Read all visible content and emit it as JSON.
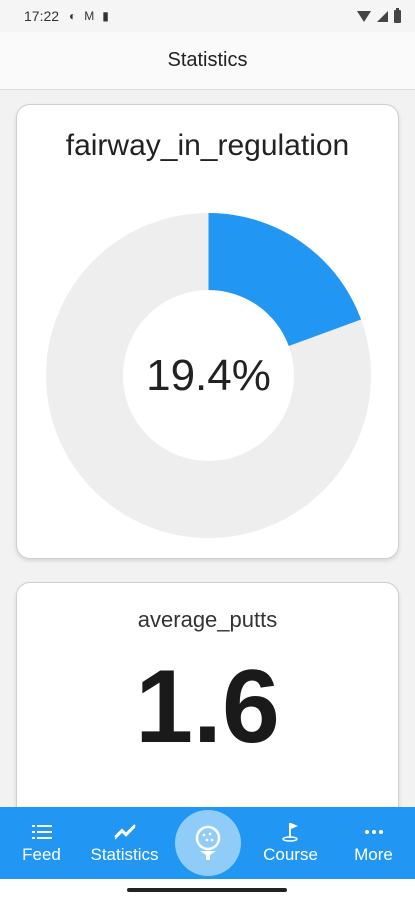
{
  "status_bar": {
    "time": "17:22"
  },
  "app_bar": {
    "title": "Statistics"
  },
  "cards": [
    {
      "title": "fairway_in_regulation",
      "value_label": "19.4%",
      "fraction": 0.194,
      "fill_color": "#2196f3",
      "track_color": "#eeeeee"
    },
    {
      "title": "average_putts",
      "value_label": "1.6"
    }
  ],
  "bottom_nav": {
    "items": [
      {
        "label": "Feed",
        "icon": "list-icon"
      },
      {
        "label": "Statistics",
        "icon": "trend-icon"
      },
      {
        "label": "",
        "icon": "golf-ball-tee-icon"
      },
      {
        "label": "Course",
        "icon": "golf-flag-icon"
      },
      {
        "label": "More",
        "icon": "more-dots-icon"
      }
    ],
    "color": "#2196f3"
  }
}
